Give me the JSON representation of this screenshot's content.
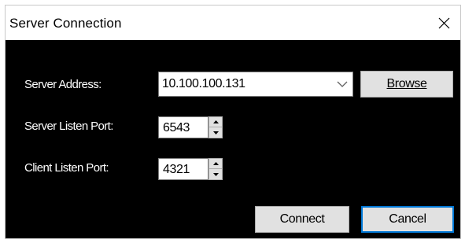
{
  "window": {
    "title": "Server Connection"
  },
  "form": {
    "server_address_label": "Server Address:",
    "server_address_value": "10.100.100.131",
    "browse_label": "Browse",
    "server_listen_port_label": "Server Listen Port:",
    "server_listen_port_value": "6543",
    "client_listen_port_label": "Client Listen Port:",
    "client_listen_port_value": "4321"
  },
  "buttons": {
    "connect_label": "Connect",
    "cancel_label": "Cancel"
  },
  "icons": {
    "close": "close-icon",
    "dropdown": "chevron-down-icon",
    "spin_up": "spin-up-icon",
    "spin_down": "spin-down-icon"
  },
  "colors": {
    "client_background": "#000000",
    "label_text": "#ffffff",
    "focus_border": "#0078d7",
    "button_face": "#e1e1e1"
  }
}
